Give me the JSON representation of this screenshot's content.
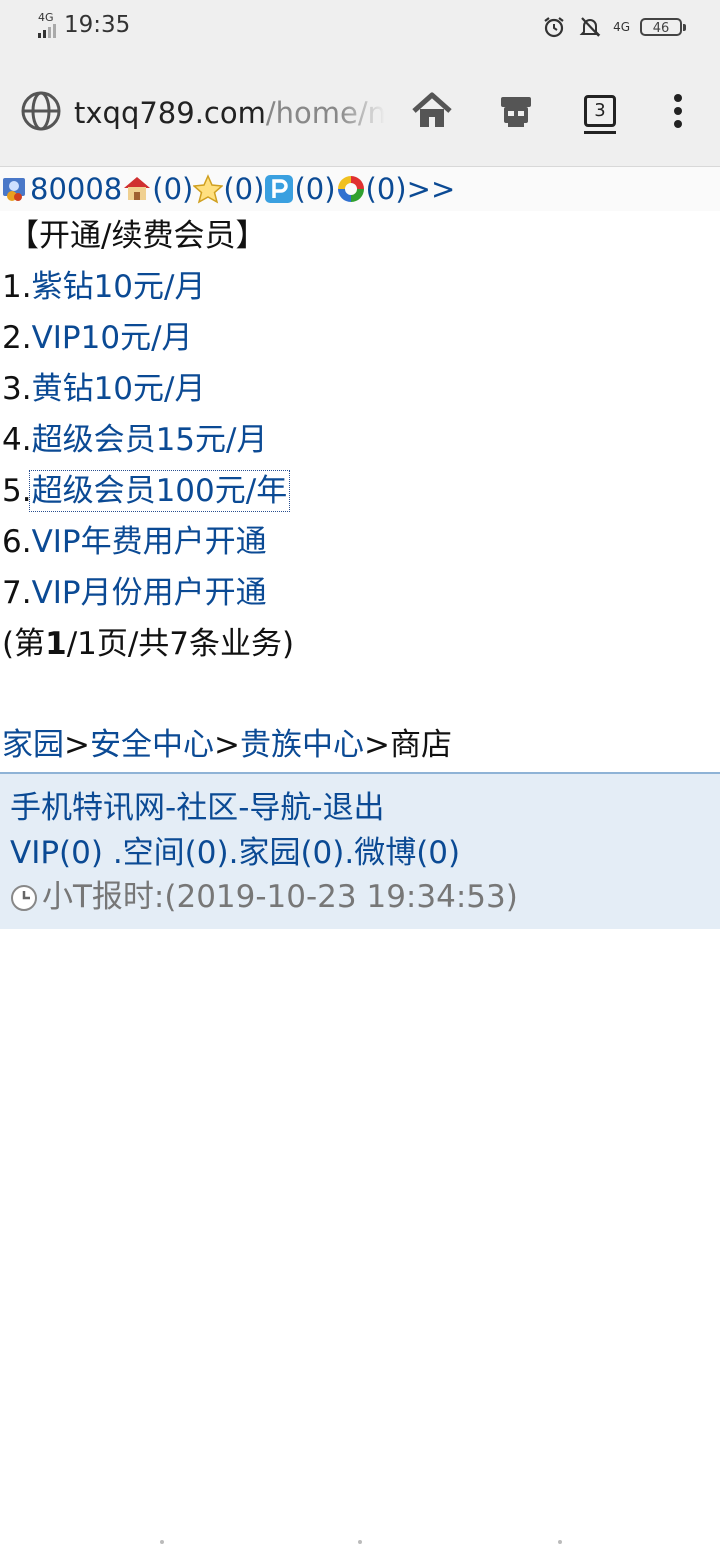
{
  "status_bar": {
    "network_left": "4G",
    "time": "19:35",
    "network_right": "4G",
    "battery": "46"
  },
  "address_bar": {
    "url_host": "txqq789.com",
    "url_path": "/home/nc",
    "tab_count": "3"
  },
  "user_bar": {
    "user_id": "80008",
    "count_home": "(0)",
    "count_star": "(0)",
    "count_p": "(0)",
    "count_circle": "(0)",
    "more": ">>"
  },
  "section_title": "【开通/续费会员】",
  "items": [
    {
      "num": "1.",
      "label": "紫钻10元/月"
    },
    {
      "num": "2.",
      "label": "VIP10元/月"
    },
    {
      "num": "3.",
      "label": "黄钻10元/月"
    },
    {
      "num": "4.",
      "label": "超级会员15元/月"
    },
    {
      "num": "5.",
      "label": "超级会员100元/年"
    },
    {
      "num": "6.",
      "label": "VIP年费用户开通"
    },
    {
      "num": "7.",
      "label": "VIP月份用户开通"
    }
  ],
  "pager": {
    "prefix": "(第",
    "page": "1",
    "suffix": "/1页/共7条业务)"
  },
  "breadcrumb": {
    "home": "家园",
    "sep": ">",
    "security": "安全中心",
    "noble": "贵族中心",
    "current": "商店"
  },
  "footer": {
    "site": "手机特讯网",
    "dash": "-",
    "community": "社区",
    "nav": "导航",
    "logout": "退出",
    "vip": "VIP(0)",
    "space": ".空间(0)",
    "home": ".家园(0)",
    "weibo": ".微博(0)",
    "time_text": "小T报时:(2019-10-23 19:34:53)"
  }
}
